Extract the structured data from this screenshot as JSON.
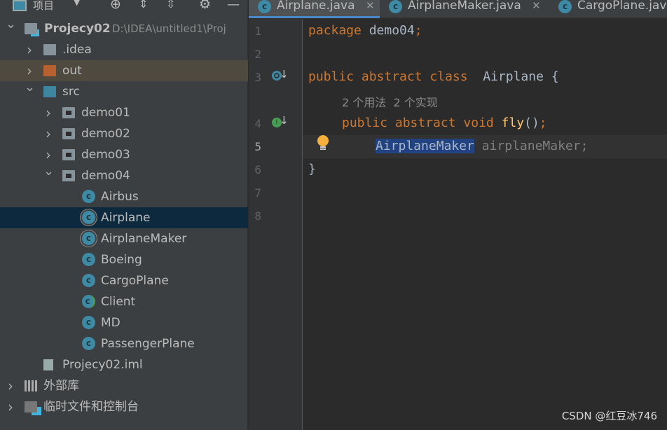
{
  "sidebar": {
    "title": "项目",
    "toolbar_icons": [
      "locate-icon",
      "expand-all-icon",
      "collapse-all-icon",
      "gear-icon",
      "minimize-icon"
    ],
    "tree": [
      {
        "label": "Projecy02",
        "extra": "D:\\IDEA\\untitled1\\Proj",
        "depth": 0,
        "expanded": true,
        "icon": "module"
      },
      {
        "label": ".idea",
        "depth": 1,
        "expanded": false,
        "icon": "folder"
      },
      {
        "label": "out",
        "depth": 1,
        "expanded": false,
        "icon": "folder-excluded",
        "highlight": true
      },
      {
        "label": "src",
        "depth": 1,
        "expanded": true,
        "icon": "folder-source"
      },
      {
        "label": "demo01",
        "depth": 2,
        "expanded": false,
        "icon": "package"
      },
      {
        "label": "demo02",
        "depth": 2,
        "expanded": false,
        "icon": "package"
      },
      {
        "label": "demo03",
        "depth": 2,
        "expanded": false,
        "icon": "package"
      },
      {
        "label": "demo04",
        "depth": 2,
        "expanded": true,
        "icon": "package"
      },
      {
        "label": "Airbus",
        "depth": 3,
        "icon": "class"
      },
      {
        "label": "Airplane",
        "depth": 3,
        "icon": "abstract-class",
        "selected": true
      },
      {
        "label": "AirplaneMaker",
        "depth": 3,
        "icon": "abstract-class"
      },
      {
        "label": "Boeing",
        "depth": 3,
        "icon": "class"
      },
      {
        "label": "CargoPlane",
        "depth": 3,
        "icon": "class"
      },
      {
        "label": "Client",
        "depth": 3,
        "icon": "runnable-class"
      },
      {
        "label": "MD",
        "depth": 3,
        "icon": "class"
      },
      {
        "label": "PassengerPlane",
        "depth": 3,
        "icon": "class"
      },
      {
        "label": "Projecy02.iml",
        "depth": 1,
        "icon": "iml-file"
      },
      {
        "label": "外部库",
        "depth": 0,
        "expanded": false,
        "icon": "libraries"
      },
      {
        "label": "临时文件和控制台",
        "depth": 0,
        "expanded": false,
        "icon": "scratches"
      }
    ]
  },
  "tabs": [
    {
      "label": "Airplane.java",
      "active": true
    },
    {
      "label": "AirplaneMaker.java"
    },
    {
      "label": "CargoPlane.java"
    }
  ],
  "editor": {
    "line_numbers": [
      "1",
      "2",
      "3",
      "4",
      "5",
      "6",
      "7",
      "8"
    ],
    "line1": {
      "kw": "package",
      "rest": " demo04",
      "semi": ";"
    },
    "line3": {
      "kw": "public abstract class",
      "name": "  Airplane {"
    },
    "hint": "2 个用法  2 个实现",
    "line4": {
      "kw": "public abstract void",
      "fn": "fly",
      "rest": "()",
      "semi": ";"
    },
    "line5": {
      "type": "AirplaneMaker",
      "rest": " airplaneMaker;"
    },
    "line6": "}"
  },
  "watermark": "CSDN @红豆冰746",
  "colors": {
    "keyword": "#cc7832",
    "selection": "#214283",
    "accent": "#4a88c7"
  }
}
